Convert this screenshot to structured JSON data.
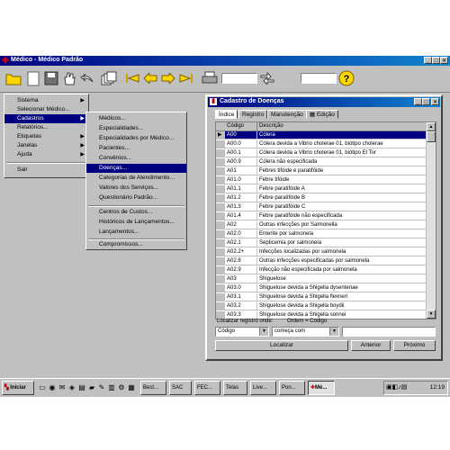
{
  "main_window": {
    "title": "Médico - Médico Padrão",
    "controls": [
      "_",
      "□",
      "×"
    ]
  },
  "toolbar": {
    "icons": [
      "folder-icon",
      "new-doc-icon",
      "save-icon",
      "hand-icon",
      "back-arrow-icon",
      "stack-icon",
      "first-record-icon",
      "prev-record-icon",
      "next-record-icon",
      "last-record-icon",
      "printer-icon",
      "dual-arrow-icon",
      "help-icon"
    ],
    "help_label": "?"
  },
  "left_menu": {
    "items": [
      {
        "label": "Sistema",
        "submenu": true
      },
      {
        "label": "Selecionar Médico...",
        "submenu": false
      },
      {
        "label": "Cadastros",
        "submenu": true,
        "selected": true
      },
      {
        "label": "Relatórios...",
        "submenu": false
      },
      {
        "label": "Etiquetas",
        "submenu": true
      },
      {
        "label": "Janelas",
        "submenu": true
      },
      {
        "label": "Ajuda",
        "submenu": true
      },
      {
        "label": "Sair",
        "submenu": false
      }
    ]
  },
  "submenu": {
    "items": [
      {
        "label": "Médicos..."
      },
      {
        "label": "Especialidades..."
      },
      {
        "label": "Especialidades por Médico..."
      },
      {
        "label": "Pacientes..."
      },
      {
        "label": "Convênios..."
      },
      {
        "label": "Doenças...",
        "selected": true
      },
      {
        "label": "Categorias de Atendimento..."
      },
      {
        "label": "Valores dos Serviços..."
      },
      {
        "label": "Questionário Padrão..."
      },
      {
        "label": "Centros de Custos..."
      },
      {
        "label": "Históricos de Lançamentos..."
      },
      {
        "label": "Lançamentos..."
      },
      {
        "label": "Compromissos..."
      }
    ]
  },
  "child_window": {
    "title": "Cadastro de Doenças",
    "tabs": [
      "Índice",
      "Registro",
      "Manutenção",
      "Edição"
    ],
    "columns": [
      "Código",
      "Descrição"
    ],
    "rows": [
      [
        "A00",
        "Cólera"
      ],
      [
        "A00.0",
        "Cólera devida a Vibrio cholerae 01, biótipo cholerae"
      ],
      [
        "A00.1",
        "Cólera devida a Vibrio cholerae 01, biótipo El Tor"
      ],
      [
        "A00.9",
        "Cólera não especificada"
      ],
      [
        "A01",
        "Febres tifóide e paratifóide"
      ],
      [
        "A01.0",
        "Febre tifóide"
      ],
      [
        "A01.1",
        "Febre paratifóide A"
      ],
      [
        "A01.2",
        "Febre paratifóide B"
      ],
      [
        "A01.3",
        "Febre paratifóide C"
      ],
      [
        "A01.4",
        "Febre paratifóide não especificada"
      ],
      [
        "A02",
        "Outras infecções por Salmonella"
      ],
      [
        "A02.0",
        "Enterite por salmonela"
      ],
      [
        "A02.1",
        "Septicemia por salmonela"
      ],
      [
        "A02.2+",
        "Infecções localizadas por salmonela"
      ],
      [
        "A02.8",
        "Outras infecções especificadas por salmonela"
      ],
      [
        "A02.9",
        "Infecção não especificada por salmonela"
      ],
      [
        "A03",
        "Shiguelose"
      ],
      [
        "A03.0",
        "Shiguelose devida a Shigella dysenteriae"
      ],
      [
        "A03.1",
        "Shiguelose devida a Shigella flexneri"
      ],
      [
        "A03.2",
        "Shiguelose devida a Shigella boydii"
      ],
      [
        "A03.3",
        "Shiguelose devida a Shigella sonnei"
      ]
    ],
    "search_label": "Localizar registro onde:",
    "order_label": "Ordem = Código",
    "field_select": "Código",
    "condition_select": "começa com",
    "search_value": "",
    "buttons": {
      "locate": "Localizar",
      "previous": "Anterior",
      "next": "Próximo"
    }
  },
  "taskbar": {
    "start_label": "Iniciar",
    "tasks": [
      "Best...",
      "SAC",
      "FEC...",
      "Telas",
      "Live...",
      "Pon...",
      "Mé..."
    ],
    "clock": "12:19"
  }
}
